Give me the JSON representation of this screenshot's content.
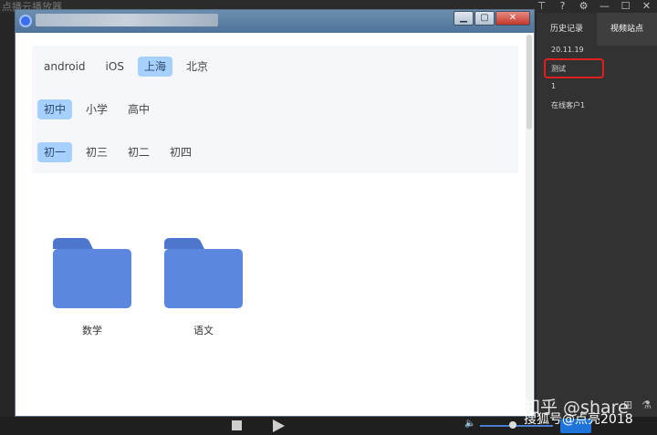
{
  "host": {
    "title": "点播云播放器",
    "controls": [
      "pin-icon",
      "help-icon",
      "settings-icon",
      "minimize-icon",
      "maximize-icon",
      "close-icon"
    ]
  },
  "right_panel": {
    "tabs": [
      {
        "label": "历史记录",
        "active": false
      },
      {
        "label": "视频站点",
        "active": true
      }
    ],
    "items": [
      {
        "label": "20.11.19"
      },
      {
        "label": "测试",
        "highlighted": true
      },
      {
        "label": "1"
      },
      {
        "label": "在线客户1"
      }
    ]
  },
  "inner_window": {
    "controls": [
      "minimize",
      "maximize",
      "close"
    ],
    "filters": [
      {
        "options": [
          {
            "label": "android",
            "selected": false
          },
          {
            "label": "iOS",
            "selected": false
          },
          {
            "label": "上海",
            "selected": true
          },
          {
            "label": "北京",
            "selected": false
          }
        ]
      },
      {
        "options": [
          {
            "label": "初中",
            "selected": true
          },
          {
            "label": "小学",
            "selected": false
          },
          {
            "label": "高中",
            "selected": false
          }
        ]
      },
      {
        "options": [
          {
            "label": "初一",
            "selected": true
          },
          {
            "label": "初三",
            "selected": false
          },
          {
            "label": "初二",
            "selected": false
          },
          {
            "label": "初四",
            "selected": false
          }
        ]
      }
    ],
    "folders": [
      {
        "label": "数学"
      },
      {
        "label": "语文"
      }
    ],
    "folder_color": "#5b87de",
    "selected_chip_color": "#a6d0ff"
  },
  "bottom_bar": {
    "accent": "#1e74d8"
  },
  "watermark": {
    "line1": "知乎 @share",
    "line2": "搜狐号@点亮2018"
  }
}
